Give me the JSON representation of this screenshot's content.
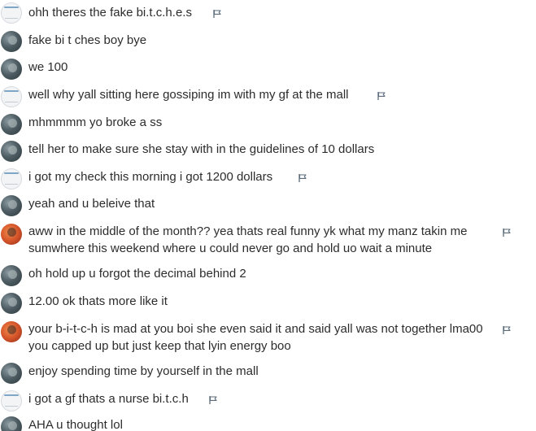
{
  "messages": [
    {
      "text": "ohh theres the fake bi.t.c.h.e.s",
      "avatar": "white",
      "flag": true
    },
    {
      "text": "fake bi t ches boy bye",
      "avatar": "dark",
      "flag": false
    },
    {
      "text": "we 100",
      "avatar": "dark",
      "flag": false
    },
    {
      "text": "well why yall sitting here gossiping im with my gf at the mall",
      "avatar": "white",
      "flag": true
    },
    {
      "text": "mhmmmm yo broke a ss",
      "avatar": "dark",
      "flag": false
    },
    {
      "text": "tell her to make sure she stay with in the guidelines of 10 dollars",
      "avatar": "dark",
      "flag": false
    },
    {
      "text": "i got my check this morning i got 1200 dollars",
      "avatar": "white",
      "flag": true
    },
    {
      "text": "yeah and u beleive that",
      "avatar": "dark",
      "flag": false
    },
    {
      "text": "aww in the middle of the month?? yea thats real funny yk what my manz takin me sumwhere this weekend where u could never go and hold uo wait a minute",
      "avatar": "red",
      "flag": true
    },
    {
      "text": "oh hold up u forgot the decimal behind 2",
      "avatar": "dark",
      "flag": false
    },
    {
      "text": "12.00 ok thats more like it",
      "avatar": "dark",
      "flag": false
    },
    {
      "text": "your b-i-t-c-h is mad at you boi she even said it and said yall was not together lma00 you capped up but just keep that lyin energy boo",
      "avatar": "red",
      "flag": true
    },
    {
      "text": "enjoy spending time by yourself in the mall",
      "avatar": "dark",
      "flag": false
    },
    {
      "text": "i got a gf thats a nurse bi.t.c.h",
      "avatar": "white",
      "flag": true
    },
    {
      "text": "AHA u thought lol",
      "avatar": "dark",
      "flag": false
    }
  ],
  "icons": {
    "flag": "flag-icon",
    "avatar": "avatar"
  },
  "colors": {
    "text": "#2c2c2c",
    "flag": "#5b6b7a",
    "background": "#ffffff"
  }
}
